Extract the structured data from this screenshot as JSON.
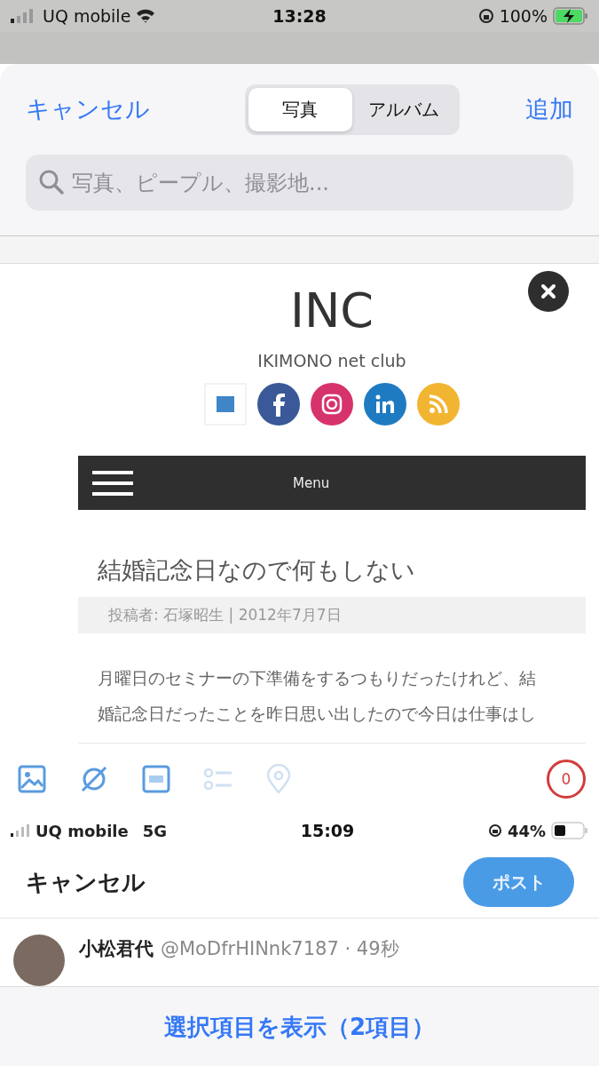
{
  "status_bar": {
    "carrier": "UQ mobile",
    "time": "13:28",
    "battery": "100%"
  },
  "picker": {
    "cancel": "キャンセル",
    "add": "追加",
    "search": {
      "placeholder": "写真、ピープル、撮影地..."
    },
    "tabs": [
      {
        "label": "写真",
        "selected": true
      },
      {
        "label": "アルバム",
        "selected": false
      }
    ]
  },
  "screenshot": {
    "site_title": "INC",
    "site_subtitle": "IKIMONO net club",
    "menu_label": "Menu",
    "post_title": "結婚記念日なので何もしない",
    "post_meta": "投稿者: 石塚昭生 | 2012年7月7日",
    "post_body": [
      "月曜日のセミナーの下準備をするつもりだったけれど、結",
      "婚記念日だったことを昨日思い出したので今日は仕事はし"
    ],
    "char_count": "0",
    "inner_status": {
      "carrier": "UQ mobile",
      "network": "5G",
      "time": "15:09",
      "battery": "44%"
    },
    "cancel": "キャンセル",
    "post_button": "ポスト",
    "tweet": {
      "name": "小松君代",
      "handle_time": "@MoDfrHINnk7187 · 49秒"
    }
  },
  "footer": {
    "show_selected": "選択項目を表示（2項目）"
  }
}
